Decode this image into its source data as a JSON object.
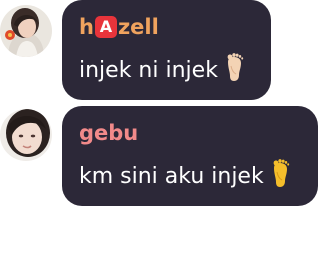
{
  "messages": [
    {
      "author_prefix": "h",
      "author_badge": "A",
      "author_suffix": "zell",
      "text": "injek ni injek",
      "emoji_icon": "foot-icon",
      "name_color": "#f0a35e",
      "emoji_color": "#f3d3b4"
    },
    {
      "author": "gebu",
      "text": "km sini aku injek",
      "emoji_icon": "foot-icon",
      "name_color": "#f28a8a",
      "emoji_color": "#f5be2b"
    }
  ],
  "colors": {
    "bubble_bg": "#2c2838",
    "message_text": "#ffffff",
    "badge_bg": "#e8343b"
  }
}
